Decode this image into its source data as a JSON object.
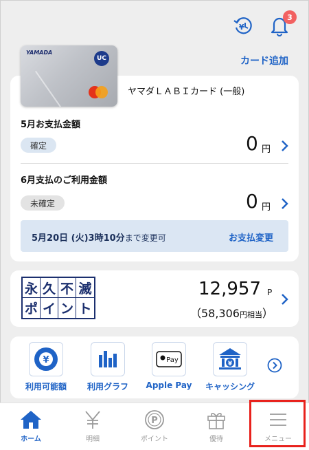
{
  "header": {
    "history_icon": "yen-history-icon",
    "bell_icon": "bell-icon",
    "notification_count": "3",
    "add_card_label": "カード追加"
  },
  "card": {
    "brand_text": "YAMADA",
    "uc_text": "UC",
    "name": "ヤマダＬＡＢＩカード (一般)"
  },
  "may_payment": {
    "label": "5月お支払金額",
    "status": "確定",
    "amount": "0",
    "unit": "円"
  },
  "june_payment": {
    "label": "6月支払のご利用金額",
    "status": "未確定",
    "amount": "0",
    "unit": "円"
  },
  "deadline": {
    "date_text": "5月20日 (火)3時10分",
    "suffix": "まで変更可",
    "change_label": "お支払変更"
  },
  "points": {
    "logo_chars": [
      "永",
      "久",
      "不",
      "滅",
      "ポ",
      "イ",
      "ン",
      "ト"
    ],
    "value": "12,957",
    "unit": "P",
    "yen_open": "（58,306",
    "yen_suffix": "円相当",
    "yen_close": "）"
  },
  "shortcuts": [
    {
      "label": "利用可能額",
      "icon": "yen-circle-icon"
    },
    {
      "label": "利用グラフ",
      "icon": "bar-chart-icon"
    },
    {
      "label": "Apple Pay",
      "icon": "apple-pay-icon",
      "icon_text": "Pay"
    },
    {
      "label": "キャッシング",
      "icon": "cashing-bank-icon"
    }
  ],
  "tabs": [
    {
      "label": "ホーム",
      "icon": "home-icon",
      "active": true
    },
    {
      "label": "明細",
      "icon": "yen-icon",
      "active": false
    },
    {
      "label": "ポイント",
      "icon": "point-icon",
      "active": false
    },
    {
      "label": "優待",
      "icon": "gift-icon",
      "active": false
    },
    {
      "label": "メニュー",
      "icon": "hamburger-icon",
      "active": false
    }
  ],
  "colors": {
    "accent": "#1f63c6",
    "badge": "#f26161",
    "highlight": "#e8211c"
  }
}
